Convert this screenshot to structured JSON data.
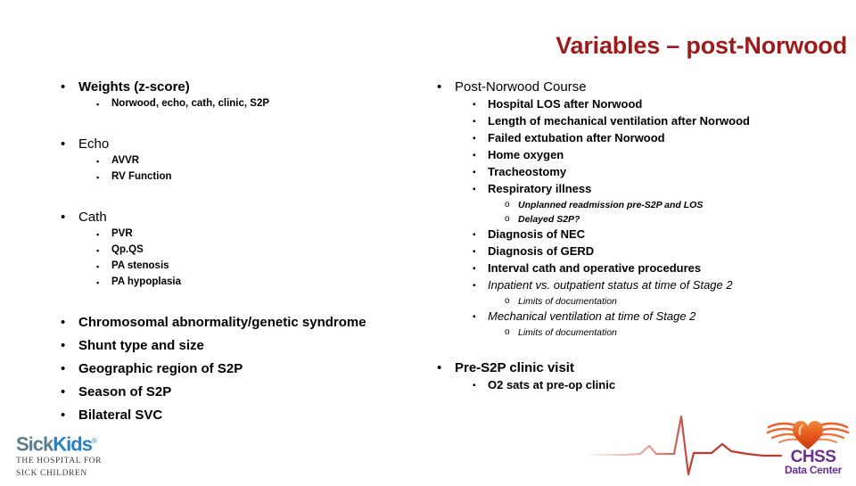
{
  "slide": {
    "title": "Variables – post-Norwood",
    "title_color": "#9E1B1B"
  },
  "left_column": {
    "groups": [
      {
        "heading": "Weights (z-score)",
        "bold": true,
        "subitems": [
          "Norwood, echo, cath, clinic, S2P"
        ]
      },
      {
        "heading": "Echo",
        "bold": false,
        "subitems": [
          "AVVR",
          "RV Function"
        ]
      },
      {
        "heading": "Cath",
        "bold": false,
        "subitems": [
          "PVR",
          "Qp.QS",
          "PA stenosis",
          "PA hypoplasia"
        ]
      }
    ],
    "plain_bullets": [
      "Chromosomal abnormality/genetic syndrome",
      "Shunt type and size",
      "Geographic region of S2P",
      "Season of S2P",
      "Bilateral SVC"
    ]
  },
  "right_column": {
    "section1_heading": "Post-Norwood Course",
    "section1_items": [
      {
        "text": "Hospital LOS after Norwood",
        "style": "bold"
      },
      {
        "text": "Length of mechanical ventilation after Norwood",
        "style": "bold"
      },
      {
        "text": "Failed extubation after Norwood",
        "style": "bold"
      },
      {
        "text": "Home oxygen",
        "style": "bold"
      },
      {
        "text": "Tracheostomy",
        "style": "bold"
      },
      {
        "text": "Respiratory illness",
        "style": "bold"
      }
    ],
    "sub_after_respiratory": [
      "Unplanned readmission pre-S2P and LOS",
      "Delayed S2P?"
    ],
    "section1_items_cont": [
      {
        "text": "Diagnosis of NEC",
        "style": "bold"
      },
      {
        "text": "Diagnosis of GERD",
        "style": "bold"
      },
      {
        "text": "Interval cath and operative procedures",
        "style": "bold"
      },
      {
        "text": "Inpatient vs. outpatient status at time of Stage 2",
        "style": "italic"
      }
    ],
    "sub_after_inpatient": [
      "Limits of documentation"
    ],
    "mech_vent_item": {
      "text": "Mechanical ventilation at time of Stage 2",
      "style": "italic"
    },
    "sub_after_mechvent": [
      "Limits of documentation"
    ],
    "section2_heading": "Pre-S2P clinic visit",
    "section2_items": [
      "O2 sats at pre-op clinic"
    ]
  },
  "logos": {
    "sickkids": {
      "word_sick": "Sick",
      "word_kids": "Kids",
      "registered": "®",
      "sub_line1": "THE HOSPITAL FOR",
      "sub_line2": "SICK CHILDREN",
      "color_sick": "#5C7D8F",
      "color_kids": "#2A80C4"
    },
    "chss": {
      "name": "CHSS",
      "sub": "Data Center",
      "color_heart": "#E8581C",
      "color_text": "#6C2F8F"
    },
    "ecg": {
      "color": "#C0392B"
    }
  },
  "bullets": {
    "level1": "•",
    "level2": "▪",
    "level3": "o"
  }
}
